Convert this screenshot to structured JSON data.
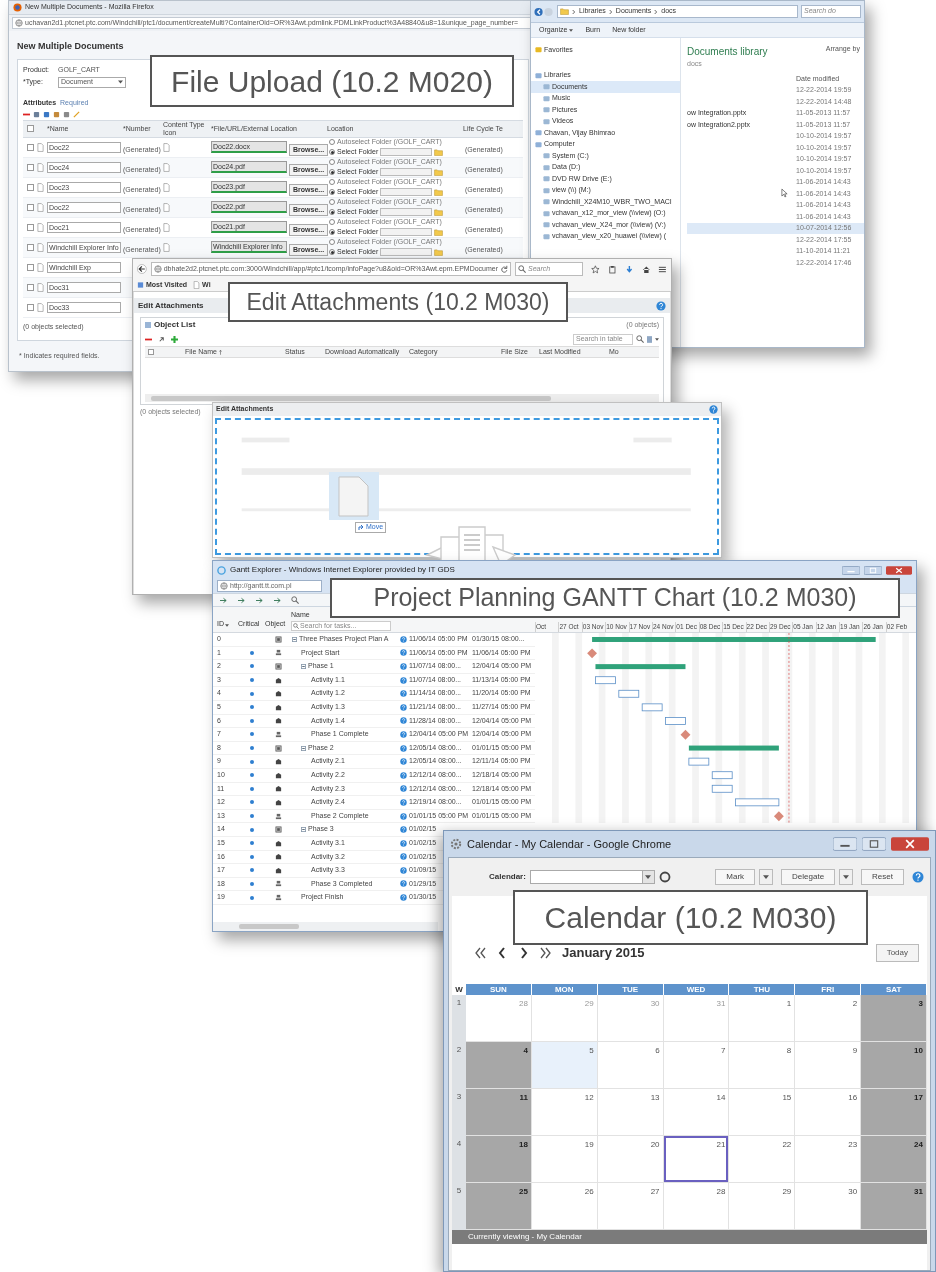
{
  "file_upload": {
    "title": "New Multiple Documents - Mozilla Firefox",
    "url": "uchavan2d1.ptcnet.ptc.com/Windchill/ptc1/document/createMulti?ContainerOid=OR%3Awt.pdmlink.PDMLinkProduct%3A48840&u8=1&unique_page_number=",
    "heading": "New Multiple Documents",
    "product_label": "Product:",
    "product": "GOLF_CART",
    "type_label": "*Type:",
    "type": "Document",
    "attributes": "Attributes",
    "required": "Required",
    "all_checked": false,
    "columns": [
      "*Name",
      "*Number",
      "Content Type Icon",
      "*File/URL/External Location",
      "Location",
      "Life Cycle Te"
    ],
    "rows": [
      {
        "checked": false,
        "name": "Doc22",
        "number": "(Generated)",
        "file": "Doc22.docx",
        "browse": "Browse...",
        "options": [
          {
            "label": "Autoselect Folder (/GOLF_CART)",
            "selected": false
          },
          {
            "label": "Select Folder",
            "selected": true
          }
        ],
        "lifecycle": "(Generated)"
      },
      {
        "checked": false,
        "name": "Doc24",
        "number": "(Generated)",
        "file": "Doc24.pdf",
        "browse": "Browse...",
        "options": [
          {
            "label": "Autoselect Folder (/GOLF_CART)",
            "selected": false
          },
          {
            "label": "Select Folder",
            "selected": true
          }
        ],
        "lifecycle": "(Generated)"
      },
      {
        "checked": false,
        "name": "Doc23",
        "number": "(Generated)",
        "file": "Doc23.pdf",
        "browse": "Browse...",
        "options": [
          {
            "label": "Autoselect Folder (/GOLF_CART)",
            "selected": false
          },
          {
            "label": "Select Folder",
            "selected": true
          }
        ],
        "lifecycle": "(Generated)"
      },
      {
        "checked": false,
        "name": "Doc22",
        "number": "(Generated)",
        "file": "Doc22.pdf",
        "browse": "Browse...",
        "options": [
          {
            "label": "Autoselect Folder (/GOLF_CART)",
            "selected": false
          },
          {
            "label": "Select Folder",
            "selected": true
          }
        ],
        "lifecycle": "(Generated)"
      },
      {
        "checked": false,
        "name": "Doc21",
        "number": "(Generated)",
        "file": "Doc21.pdf",
        "browse": "Browse...",
        "options": [
          {
            "label": "Autoselect Folder (/GOLF_CART)",
            "selected": false
          },
          {
            "label": "Select Folder",
            "selected": true
          }
        ],
        "lifecycle": "(Generated)"
      },
      {
        "checked": false,
        "name": "Windchill Explorer Info",
        "number": "(Generated)",
        "file": "Windchill Explorer Info",
        "browse": "Browse...",
        "options": [
          {
            "label": "Autoselect Folder (/GOLF_CART)",
            "selected": false
          },
          {
            "label": "Select Folder",
            "selected": true
          }
        ],
        "lifecycle": "(Generated)"
      },
      {
        "checked": false,
        "name": "Windchill Exp"
      },
      {
        "checked": false,
        "name": "Doc31"
      },
      {
        "checked": false,
        "name": "Doc33"
      }
    ],
    "selected_count": "(0 objects selected)",
    "note": "* Indicates required fields.",
    "callout": "File Upload (10.2 M020)"
  },
  "file_explorer": {
    "path": [
      "Libraries",
      "Documents",
      "docs"
    ],
    "search": "Search do",
    "toolbar": [
      "Organize",
      "Burn",
      "New folder"
    ],
    "nav": [
      {
        "label": "Favorites",
        "selected": false
      },
      {
        "label": "Libraries",
        "selected": false,
        "children": [
          {
            "label": "Documents",
            "selected": true
          },
          {
            "label": "Music",
            "selected": false
          },
          {
            "label": "Pictures",
            "selected": false
          },
          {
            "label": "Videos",
            "selected": false
          }
        ]
      },
      {
        "label": "Chavan, Vijay Bhimrao",
        "selected": false
      },
      {
        "label": "Computer",
        "selected": false,
        "children": [
          {
            "label": "System (C:)",
            "selected": false
          },
          {
            "label": "Data (D:)",
            "selected": false
          },
          {
            "label": "DVD RW Drive (E:)",
            "selected": false
          },
          {
            "label": "view (\\\\) (M:)",
            "selected": false
          },
          {
            "label": "Windchill_X24M10_WBR_TWO_MACI",
            "selected": false
          },
          {
            "label": "vchavan_x12_mor_view (\\\\view) (O:)",
            "selected": false
          },
          {
            "label": "vchavan_view_X24_mor (\\\\view) (V:)",
            "selected": false
          },
          {
            "label": "vchavan_view_x20_huawei (\\\\view) (",
            "selected": false
          }
        ]
      }
    ],
    "library_title": "Documents library",
    "library_sub": "docs",
    "arrange": "Arrange by",
    "date_column": "Date modified",
    "files": [
      {
        "date": "12-22-2014 19:59",
        "selected": false
      },
      {
        "date": "12-22-2014 14:48",
        "selected": false
      },
      {
        "name": "ow Integration.pptx",
        "date": "11-05-2013 11:57",
        "selected": false
      },
      {
        "name": "ow Integration2.pptx",
        "date": "11-05-2013 11:57",
        "selected": false
      },
      {
        "date": "10-10-2014 19:57",
        "selected": false
      },
      {
        "date": "10-10-2014 19:57",
        "selected": false
      },
      {
        "date": "10-10-2014 19:57",
        "selected": false
      },
      {
        "date": "10-10-2014 19:57",
        "selected": false
      },
      {
        "date": "11-06-2014 14:43",
        "selected": false
      },
      {
        "date": "11-06-2014 14:43",
        "selected": false
      },
      {
        "date": "11-06-2014 14:43",
        "selected": false
      },
      {
        "date": "11-06-2014 14:43",
        "selected": false
      },
      {
        "date": "10-07-2014 12:56",
        "selected": true
      },
      {
        "date": "12-22-2014 17:55",
        "selected": false
      },
      {
        "date": "11-10-2014 11:21",
        "selected": false
      },
      {
        "date": "12-22-2014 17:46",
        "selected": false
      }
    ]
  },
  "attachments": {
    "url": "dbhate2d2.ptcnet.ptc.com:3000/Windchill/app/#ptc1/tcomp/infoPage?u8&oid=OR%3Awt.epm.EPMDocumer",
    "search": "Search",
    "bookmarks": [
      "Most Visited",
      "Wi"
    ],
    "heading": "Edit Attachments",
    "panel": "Object List",
    "count": "(0 objects)",
    "table_search": "Search in table",
    "all_checked": false,
    "columns": [
      "File Name",
      "Status",
      "Download Automatically",
      "Category",
      "File Size",
      "Last Modified",
      "Mo"
    ],
    "selected_count": "(0 objects selected)",
    "callout": "Edit Attachments (10.2 M030)"
  },
  "drop_dialog": {
    "heading": "Edit Attachments",
    "tooltip": "Move"
  },
  "gantt": {
    "title": "Gantt Explorer - Windows Internet Explorer provided by IT GDS",
    "url": "http://gantt.tt.com.pl",
    "columns": [
      "ID",
      "Critical",
      "Object",
      "Name"
    ],
    "search": "Search for tasks...",
    "timeline": [
      "Oct",
      "27 Oct",
      "03 Nov",
      "10 Nov",
      "17 Nov",
      "24 Nov",
      "01 Dec",
      "08 Dec",
      "15 Dec",
      "22 Dec",
      "29 Dec",
      "05 Jan",
      "12 Jan",
      "19 Jan",
      "26 Jan",
      "02 Feb"
    ],
    "rows": [
      {
        "id": "0",
        "critical": false,
        "kind": "summary",
        "expanded": true,
        "name": "Three Phases Project Plan A",
        "start": "11/06/14 05:00 PM",
        "end": "01/30/15 08:00...",
        "children": [
          {
            "id": "1",
            "critical": true,
            "kind": "milestone",
            "name": "Project Start",
            "start": "11/06/14 05:00 PM",
            "end": "11/06/14 05:00 PM"
          },
          {
            "id": "2",
            "critical": true,
            "kind": "summary",
            "expanded": true,
            "name": "Phase 1",
            "start": "11/07/14 08:00...",
            "end": "12/04/14 05:00 PM",
            "children": [
              {
                "id": "3",
                "critical": true,
                "kind": "task",
                "name": "Activity 1.1",
                "start": "11/07/14 08:00...",
                "end": "11/13/14 05:00 PM"
              },
              {
                "id": "4",
                "critical": true,
                "kind": "task",
                "name": "Activity 1.2",
                "start": "11/14/14 08:00...",
                "end": "11/20/14 05:00 PM"
              },
              {
                "id": "5",
                "critical": true,
                "kind": "task",
                "name": "Activity 1.3",
                "start": "11/21/14 08:00...",
                "end": "11/27/14 05:00 PM"
              },
              {
                "id": "6",
                "critical": true,
                "kind": "task",
                "name": "Activity 1.4",
                "start": "11/28/14 08:00...",
                "end": "12/04/14 05:00 PM"
              },
              {
                "id": "7",
                "critical": true,
                "kind": "milestone",
                "name": "Phase 1 Complete",
                "start": "12/04/14 05:00 PM",
                "end": "12/04/14 05:00 PM"
              }
            ]
          },
          {
            "id": "8",
            "critical": true,
            "kind": "summary",
            "expanded": true,
            "name": "Phase 2",
            "start": "12/05/14 08:00...",
            "end": "01/01/15 05:00 PM",
            "children": [
              {
                "id": "9",
                "critical": true,
                "kind": "task",
                "name": "Activity 2.1",
                "start": "12/05/14 08:00...",
                "end": "12/11/14 05:00 PM"
              },
              {
                "id": "10",
                "critical": true,
                "kind": "task",
                "name": "Activity 2.2",
                "start": "12/12/14 08:00...",
                "end": "12/18/14 05:00 PM"
              },
              {
                "id": "11",
                "critical": true,
                "kind": "task",
                "name": "Activity 2.3",
                "start": "12/12/14 08:00...",
                "end": "12/18/14 05:00 PM"
              },
              {
                "id": "12",
                "critical": true,
                "kind": "task",
                "name": "Activity 2.4",
                "start": "12/19/14 08:00...",
                "end": "01/01/15 05:00 PM"
              },
              {
                "id": "13",
                "critical": true,
                "kind": "milestone",
                "name": "Phase 2 Complete",
                "start": "01/01/15 05:00 PM",
                "end": "01/01/15 05:00 PM"
              }
            ]
          },
          {
            "id": "14",
            "critical": true,
            "kind": "summary",
            "expanded": true,
            "name": "Phase 3",
            "start": "01/02/15",
            "children": [
              {
                "id": "15",
                "critical": true,
                "kind": "task",
                "name": "Activity 3.1",
                "start": "01/02/15"
              },
              {
                "id": "16",
                "critical": true,
                "kind": "task",
                "name": "Activity 3.2",
                "start": "01/02/15"
              },
              {
                "id": "17",
                "critical": true,
                "kind": "task",
                "name": "Activity 3.3",
                "start": "01/09/15"
              },
              {
                "id": "18",
                "critical": true,
                "kind": "milestone",
                "name": "Phase 3 Completed",
                "start": "01/29/15"
              }
            ]
          },
          {
            "id": "19",
            "critical": true,
            "kind": "milestone",
            "name": "Project Finish",
            "start": "01/30/15"
          }
        ]
      }
    ],
    "callout": "Project Planning GANTT Chart (10.2 M030)"
  },
  "calendar": {
    "title": "Calendar - My Calendar - Google Chrome",
    "label": "Calendar:",
    "buttons": [
      "Mark",
      "Delegate",
      "Reset"
    ],
    "month": "January 2015",
    "today": "Today",
    "week_label": "W",
    "days": [
      "SUN",
      "MON",
      "TUE",
      "WED",
      "THU",
      "FRI",
      "SAT"
    ],
    "weeks": [
      {
        "week": "1",
        "days": [
          {
            "day": "28",
            "kind": "other",
            "selected": false
          },
          {
            "day": "29",
            "kind": "other",
            "selected": false
          },
          {
            "day": "30",
            "kind": "other",
            "selected": false
          },
          {
            "day": "31",
            "kind": "other",
            "selected": false
          },
          {
            "day": "1",
            "kind": "weekday",
            "selected": false
          },
          {
            "day": "2",
            "kind": "weekday",
            "selected": false
          },
          {
            "day": "3",
            "kind": "weekend",
            "selected": false
          }
        ]
      },
      {
        "week": "2",
        "days": [
          {
            "day": "4",
            "kind": "weekend",
            "selected": false
          },
          {
            "day": "5",
            "kind": "today",
            "selected": false
          },
          {
            "day": "6",
            "kind": "weekday",
            "selected": false
          },
          {
            "day": "7",
            "kind": "weekday",
            "selected": false
          },
          {
            "day": "8",
            "kind": "weekday",
            "selected": false
          },
          {
            "day": "9",
            "kind": "weekday",
            "selected": false
          },
          {
            "day": "10",
            "kind": "weekend",
            "selected": false
          }
        ]
      },
      {
        "week": "3",
        "days": [
          {
            "day": "11",
            "kind": "weekend",
            "selected": false
          },
          {
            "day": "12",
            "kind": "weekday",
            "selected": false
          },
          {
            "day": "13",
            "kind": "weekday",
            "selected": false
          },
          {
            "day": "14",
            "kind": "weekday",
            "selected": false
          },
          {
            "day": "15",
            "kind": "weekday",
            "selected": false
          },
          {
            "day": "16",
            "kind": "weekday",
            "selected": false
          },
          {
            "day": "17",
            "kind": "weekend",
            "selected": false
          }
        ]
      },
      {
        "week": "4",
        "days": [
          {
            "day": "18",
            "kind": "weekend",
            "selected": false
          },
          {
            "day": "19",
            "kind": "weekday",
            "selected": false
          },
          {
            "day": "20",
            "kind": "weekday",
            "selected": false
          },
          {
            "day": "21",
            "kind": "weekday",
            "selected": true
          },
          {
            "day": "22",
            "kind": "weekday",
            "selected": false
          },
          {
            "day": "23",
            "kind": "weekday",
            "selected": false
          },
          {
            "day": "24",
            "kind": "weekend",
            "selected": false
          }
        ]
      },
      {
        "week": "5",
        "days": [
          {
            "day": "25",
            "kind": "weekend",
            "selected": false
          },
          {
            "day": "26",
            "kind": "weekday",
            "selected": false
          },
          {
            "day": "27",
            "kind": "weekday",
            "selected": false
          },
          {
            "day": "28",
            "kind": "weekday",
            "selected": false
          },
          {
            "day": "29",
            "kind": "weekday",
            "selected": false
          },
          {
            "day": "30",
            "kind": "weekday",
            "selected": false
          },
          {
            "day": "31",
            "kind": "weekend",
            "selected": false
          }
        ]
      }
    ],
    "footer": "Currently viewing - My Calendar",
    "callout": "Calendar (10.2 M030)"
  }
}
